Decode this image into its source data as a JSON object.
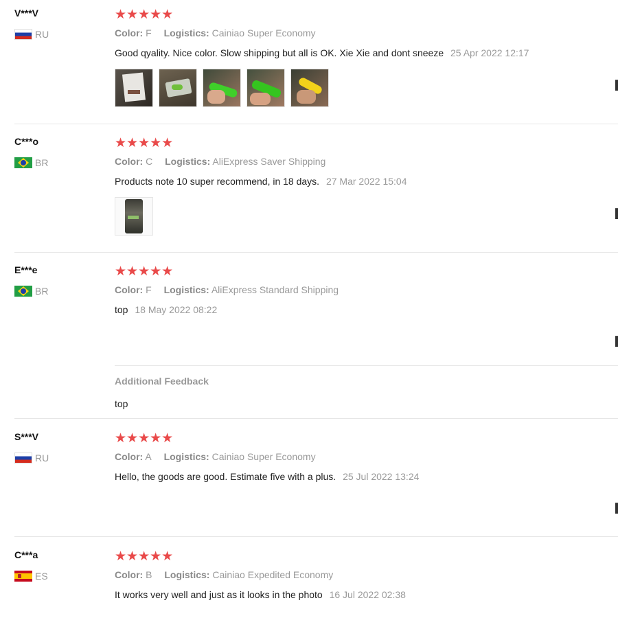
{
  "reviews": [
    {
      "user": "V***V",
      "country": "RU",
      "stars": "★★★★★",
      "color_label": "Color:",
      "color_value": "F",
      "logistics_label": "Logistics:",
      "logistics_value": "Cainiao Super Economy",
      "text": "Good qyality. Nice color. Slow shipping but all is OK. Xie Xie and dont sneeze",
      "date": "25 Apr 2022 12:17",
      "photo_count": 5
    },
    {
      "user": "C***o",
      "country": "BR",
      "stars": "★★★★★",
      "color_label": "Color:",
      "color_value": "C",
      "logistics_label": "Logistics:",
      "logistics_value": "AliExpress Saver Shipping",
      "text": "Products note 10 super recommend, in 18 days.",
      "date": "27 Mar 2022 15:04",
      "photo_count": 1
    },
    {
      "user": "E***e",
      "country": "BR",
      "stars": "★★★★★",
      "color_label": "Color:",
      "color_value": "F",
      "logistics_label": "Logistics:",
      "logistics_value": "AliExpress Standard Shipping",
      "text": "top",
      "date": "18 May 2022 08:22",
      "additional_feedback_title": "Additional Feedback",
      "additional_feedback_text": "top"
    },
    {
      "user": "S***V",
      "country": "RU",
      "stars": "★★★★★",
      "color_label": "Color:",
      "color_value": "A",
      "logistics_label": "Logistics:",
      "logistics_value": "Cainiao Super Economy",
      "text": "Hello, the goods are good. Estimate five with a plus.",
      "date": "25 Jul 2022 13:24"
    },
    {
      "user": "C***a",
      "country": "ES",
      "stars": "★★★★★",
      "color_label": "Color:",
      "color_value": "B",
      "logistics_label": "Logistics:",
      "logistics_value": "Cainiao Expedited Economy",
      "text": "It works very well and just as it looks in the photo",
      "date": "16 Jul 2022 02:38"
    }
  ],
  "colors": {
    "star": "#e94a4a",
    "muted": "#999999",
    "divider": "#e6e6e6"
  }
}
